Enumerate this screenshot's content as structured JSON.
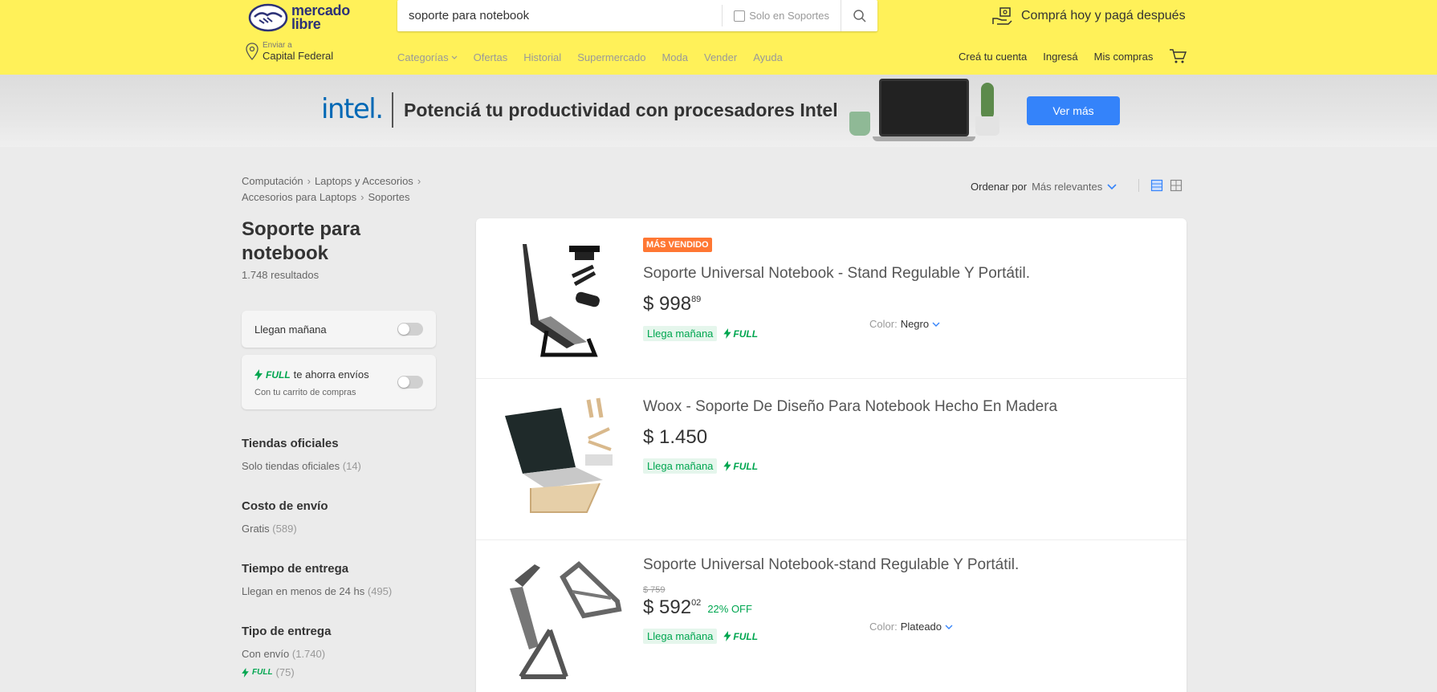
{
  "header": {
    "logo_line1": "mercado",
    "logo_line2": "libre",
    "search": {
      "value": "soporte para notebook",
      "filter_label": "Solo en Soportes"
    },
    "promo": "Comprá hoy y pagá después",
    "location": {
      "small": "Enviar a",
      "big": "Capital Federal"
    },
    "nav": [
      "Categorías",
      "Ofertas",
      "Historial",
      "Supermercado",
      "Moda",
      "Vender",
      "Ayuda"
    ],
    "user_nav": [
      "Creá tu cuenta",
      "Ingresá",
      "Mis compras"
    ]
  },
  "banner": {
    "brand": "intel.",
    "text": "Potenciá tu productividad con procesadores Intel",
    "button": "Ver más"
  },
  "breadcrumb": [
    "Computación",
    "Laptops y Accesorios",
    "Accesorios para Laptops",
    "Soportes"
  ],
  "sort": {
    "label": "Ordenar por",
    "value": "Más relevantes"
  },
  "sidebar": {
    "title": "Soporte para notebook",
    "count": "1.748 resultados",
    "tomorrow": "Llegan mañana",
    "full_label": "FULL",
    "full_text": "te ahorra envíos",
    "full_sub": "Con tu carrito de compras",
    "sections": [
      {
        "title": "Tiendas oficiales",
        "items": [
          {
            "label": "Solo tiendas oficiales",
            "count": "(14)"
          }
        ]
      },
      {
        "title": "Costo de envío",
        "items": [
          {
            "label": "Gratis",
            "count": "(589)"
          }
        ]
      },
      {
        "title": "Tiempo de entrega",
        "items": [
          {
            "label": "Llegan en menos de 24 hs",
            "count": "(495)"
          }
        ]
      },
      {
        "title": "Tipo de entrega",
        "items": [
          {
            "label": "Con envío",
            "count": "(1.740)"
          },
          {
            "label": "FULL",
            "count": "(75)"
          }
        ]
      }
    ]
  },
  "results": [
    {
      "badge": "MÁS VENDIDO",
      "title": "Soporte Universal Notebook - Stand Regulable Y Portátil.",
      "price": "$ 998",
      "cents": "89",
      "arrives": "Llega mañana",
      "full": "FULL",
      "color_label": "Color:",
      "color_value": "Negro"
    },
    {
      "title": "Woox - Soporte De Diseño Para Notebook Hecho En Madera",
      "price": "$ 1.450",
      "arrives": "Llega mañana",
      "full": "FULL"
    },
    {
      "title": "Soporte Universal Notebook-stand Regulable Y Portátil.",
      "old_price": "$ 759",
      "price": "$ 592",
      "cents": "02",
      "off": "22% OFF",
      "arrives": "Llega mañana",
      "full": "FULL",
      "color_label": "Color:",
      "color_value": "Plateado"
    }
  ],
  "colors": {
    "header_bg": "#fff159",
    "accent": "#3483fa",
    "green": "#00a650",
    "badge": "#ff7733"
  }
}
